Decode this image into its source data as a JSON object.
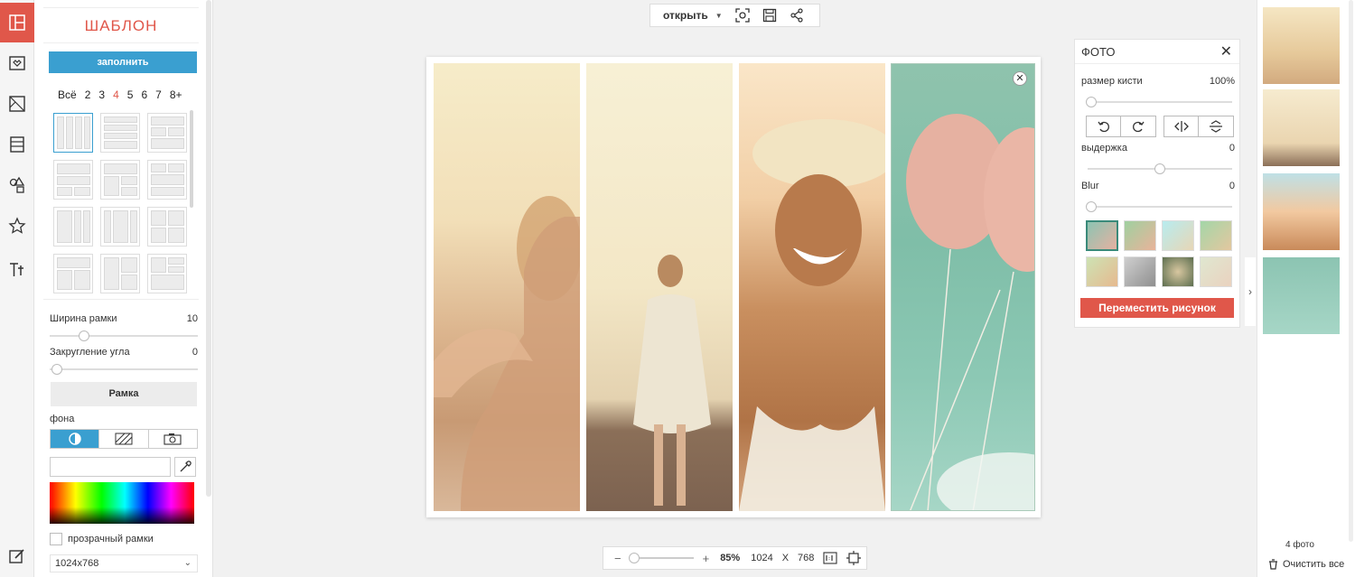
{
  "left_panel": {
    "title": "ШАБЛОН",
    "fill_button": "заполнить",
    "counts": [
      "Всё",
      "2",
      "3",
      "4",
      "5",
      "6",
      "7",
      "8+"
    ],
    "selected_count": "4",
    "border_width_label": "Ширина рамки",
    "border_width_value": "10",
    "corner_radius_label": "Закругление угла",
    "corner_radius_value": "0",
    "frame_button": "Рамка",
    "background_label": "фона",
    "transparent_label": "прозрачный рамки",
    "canvas_size": "1024x768"
  },
  "toolbar": {
    "open_label": "открыть"
  },
  "photo_panel": {
    "title": "ФОТО",
    "brush_size_label": "размер кисти",
    "brush_size_value": "100%",
    "exposure_label": "выдержка",
    "exposure_value": "0",
    "blur_label": "Blur",
    "blur_value": "0",
    "move_button": "Переместить рисунок"
  },
  "thumbnails": {
    "count_label": "4 фото",
    "clear_all_label": "Очистить все"
  },
  "zoom": {
    "minus": "−",
    "plus": "+",
    "percent": "85%",
    "width": "1024",
    "x": "X",
    "height": "768"
  },
  "colors": {
    "accent_red": "#e0574a",
    "accent_blue": "#3a9fd0"
  }
}
